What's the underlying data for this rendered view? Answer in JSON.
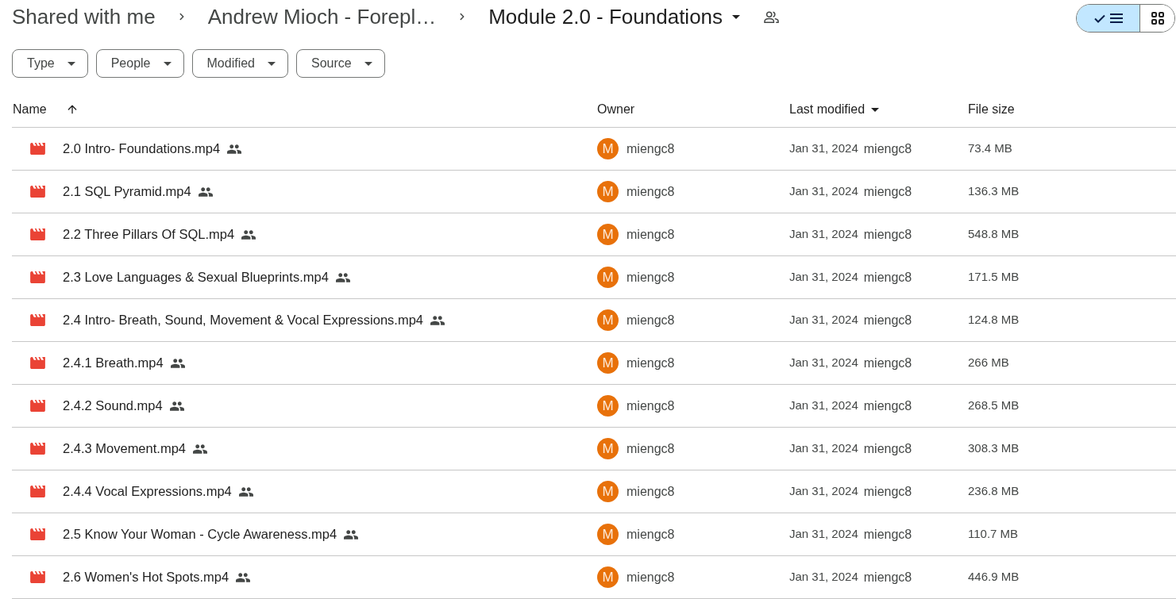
{
  "breadcrumb": {
    "items": [
      {
        "label": "Shared with me"
      },
      {
        "label": "Andrew Mioch - Forepl…"
      }
    ],
    "current": {
      "label": "Module 2.0 - Foundations",
      "shared": true
    }
  },
  "view_toggle": [
    {
      "kind": "list",
      "selected": true
    },
    {
      "kind": "grid",
      "selected": false
    }
  ],
  "filters": [
    {
      "label": "Type"
    },
    {
      "label": "People"
    },
    {
      "label": "Modified"
    },
    {
      "label": "Source"
    }
  ],
  "table": {
    "columns": [
      {
        "label": "Name",
        "kind": "sort",
        "ascending": true
      },
      {
        "label": "Owner",
        "kind": "plain"
      },
      {
        "label": "Last modified",
        "kind": "menu"
      },
      {
        "label": "File size",
        "kind": "plain"
      }
    ],
    "rows": [
      {
        "name": "2.0 Intro- Foundations.mp4",
        "shared": true,
        "owner_initial": "M",
        "owner": "miengc8",
        "modified_date": "Jan 31, 2024",
        "modified_by": "miengc8",
        "size": "73.4 MB"
      },
      {
        "name": "2.1 SQL Pyramid.mp4",
        "shared": true,
        "owner_initial": "M",
        "owner": "miengc8",
        "modified_date": "Jan 31, 2024",
        "modified_by": "miengc8",
        "size": "136.3 MB"
      },
      {
        "name": "2.2 Three Pillars Of SQL.mp4",
        "shared": true,
        "owner_initial": "M",
        "owner": "miengc8",
        "modified_date": "Jan 31, 2024",
        "modified_by": "miengc8",
        "size": "548.8 MB"
      },
      {
        "name": "2.3 Love Languages & Sexual Blueprints.mp4",
        "shared": true,
        "owner_initial": "M",
        "owner": "miengc8",
        "modified_date": "Jan 31, 2024",
        "modified_by": "miengc8",
        "size": "171.5 MB"
      },
      {
        "name": "2.4 Intro- Breath, Sound, Movement & Vocal Expressions.mp4",
        "shared": true,
        "owner_initial": "M",
        "owner": "miengc8",
        "modified_date": "Jan 31, 2024",
        "modified_by": "miengc8",
        "size": "124.8 MB"
      },
      {
        "name": "2.4.1 Breath.mp4",
        "shared": true,
        "owner_initial": "M",
        "owner": "miengc8",
        "modified_date": "Jan 31, 2024",
        "modified_by": "miengc8",
        "size": "266 MB"
      },
      {
        "name": "2.4.2 Sound.mp4",
        "shared": true,
        "owner_initial": "M",
        "owner": "miengc8",
        "modified_date": "Jan 31, 2024",
        "modified_by": "miengc8",
        "size": "268.5 MB"
      },
      {
        "name": "2.4.3 Movement.mp4",
        "shared": true,
        "owner_initial": "M",
        "owner": "miengc8",
        "modified_date": "Jan 31, 2024",
        "modified_by": "miengc8",
        "size": "308.3 MB"
      },
      {
        "name": "2.4.4 Vocal Expressions.mp4",
        "shared": true,
        "owner_initial": "M",
        "owner": "miengc8",
        "modified_date": "Jan 31, 2024",
        "modified_by": "miengc8",
        "size": "236.8 MB"
      },
      {
        "name": "2.5 Know Your Woman - Cycle Awareness.mp4",
        "shared": true,
        "owner_initial": "M",
        "owner": "miengc8",
        "modified_date": "Jan 31, 2024",
        "modified_by": "miengc8",
        "size": "110.7 MB"
      },
      {
        "name": "2.6 Women's Hot Spots.mp4",
        "shared": true,
        "owner_initial": "M",
        "owner": "miengc8",
        "modified_date": "Jan 31, 2024",
        "modified_by": "miengc8",
        "size": "446.9 MB"
      }
    ]
  }
}
